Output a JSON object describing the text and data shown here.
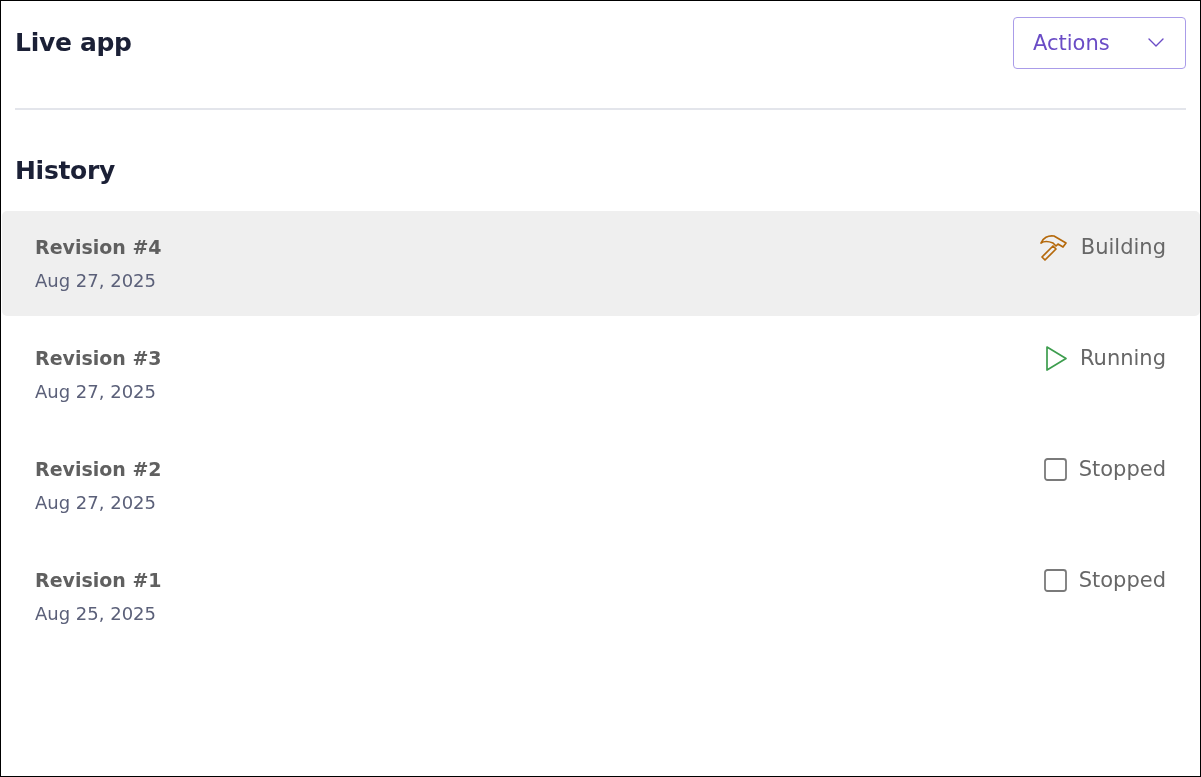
{
  "header": {
    "title": "Live app",
    "actions_button": {
      "label": "Actions"
    }
  },
  "history": {
    "heading": "History",
    "revisions": [
      {
        "title": "Revision #4",
        "date": "Aug 27, 2025",
        "selected": true,
        "status": {
          "kind": "building",
          "label": "Building"
        }
      },
      {
        "title": "Revision #3",
        "date": "Aug 27, 2025",
        "selected": false,
        "status": {
          "kind": "running",
          "label": "Running"
        }
      },
      {
        "title": "Revision #2",
        "date": "Aug 27, 2025",
        "selected": false,
        "status": {
          "kind": "stopped",
          "label": "Stopped"
        }
      },
      {
        "title": "Revision #1",
        "date": "Aug 25, 2025",
        "selected": false,
        "status": {
          "kind": "stopped",
          "label": "Stopped"
        }
      }
    ]
  }
}
